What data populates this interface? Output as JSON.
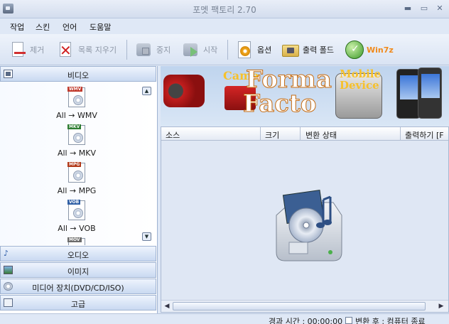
{
  "window": {
    "title": "포멧 팩토리 2.70"
  },
  "menu": [
    "작업",
    "스킨",
    "언어",
    "도움말"
  ],
  "toolbar": {
    "remove": "제거",
    "clear_list": "목록 지우기",
    "stop": "중지",
    "start": "시작",
    "options": "옵션",
    "output_folder": "출력 폴드",
    "win7z": "Win7z"
  },
  "sidebar": {
    "video": "비디오",
    "audio": "오디오",
    "image": "이미지",
    "media_device": "미디어 장치(DVD/CD/ISO)",
    "advanced": "고급",
    "formats": [
      {
        "tag": "WMV",
        "label": "All → WMV",
        "color": "#c0392b"
      },
      {
        "tag": "MKV",
        "label": "All → MKV",
        "color": "#2e7d32"
      },
      {
        "tag": "MPG",
        "label": "All → MPG",
        "color": "#b23a1a"
      },
      {
        "tag": "VOB",
        "label": "All → VOB",
        "color": "#2f5fa5"
      },
      {
        "tag": "MOV",
        "label": "",
        "color": "#6b6b6b"
      }
    ]
  },
  "banner": {
    "camera": "Came",
    "line1": "Forma",
    "line2": "Facto",
    "mobile": "Mobile",
    "device": "Device"
  },
  "table": {
    "columns": [
      "소스",
      "크기",
      "변환 상태",
      "출력하기 [F"
    ]
  },
  "status": {
    "elapsed": "경과 시간 : 00:00:00",
    "after_convert": "변환 후 : 컴퓨터 종료"
  },
  "colors": {
    "accent": "#f08a1c",
    "panel": "#dfe8f6"
  }
}
